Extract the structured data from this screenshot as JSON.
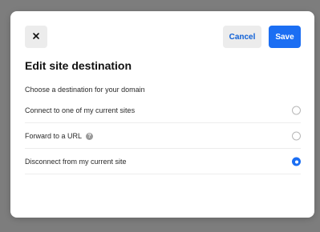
{
  "toolbar": {
    "close_icon": "close-icon",
    "cancel_label": "Cancel",
    "save_label": "Save"
  },
  "dialog": {
    "title": "Edit site destination",
    "subtitle": "Choose a destination for your domain"
  },
  "options": [
    {
      "label": "Connect to one of my current sites",
      "selected": false,
      "has_help": false
    },
    {
      "label": "Forward to a URL",
      "selected": false,
      "has_help": true,
      "help_icon": "help-icon"
    },
    {
      "label": "Disconnect from my current site",
      "selected": true,
      "has_help": false
    }
  ],
  "colors": {
    "accent": "#1b6ef3",
    "backdrop": "#7d7d7d",
    "secondary_button": "#ececec"
  }
}
